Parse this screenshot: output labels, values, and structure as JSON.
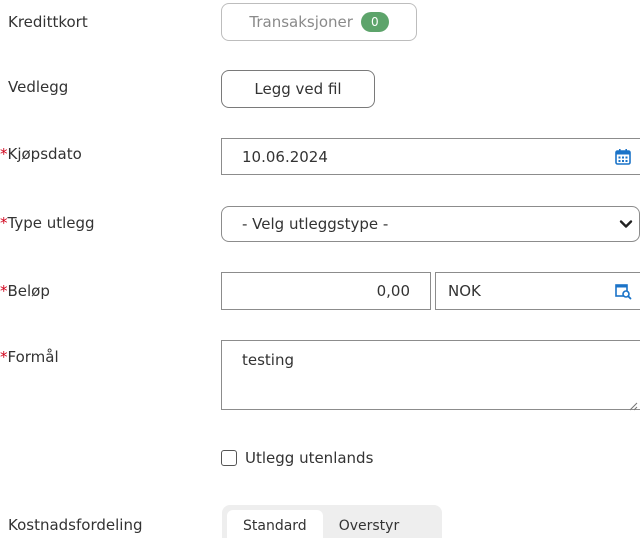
{
  "form": {
    "creditcard": {
      "label": "Kredittkort",
      "button_label": "Transaksjoner",
      "badge_count": "0"
    },
    "attachment": {
      "label": "Vedlegg",
      "button_label": "Legg ved fil"
    },
    "purchase_date": {
      "required_mark": "*",
      "label": "Kjøpsdato",
      "value": "10.06.2024"
    },
    "expense_type": {
      "required_mark": "*",
      "label": "Type utlegg",
      "value": "- Velg utleggstype -"
    },
    "amount": {
      "required_mark": "*",
      "label": "Beløp",
      "value": "0,00",
      "currency": "NOK"
    },
    "purpose": {
      "required_mark": "*",
      "label": "Formål",
      "value": "testing"
    },
    "abroad": {
      "label": "Utlegg utenlands",
      "checked": false
    },
    "cost_distribution": {
      "label": "Kostnadsfordeling",
      "options": [
        "Standard",
        "Overstyr"
      ],
      "selected": "Standard"
    }
  },
  "colors": {
    "required": "#d0021b",
    "badge": "#5da46b",
    "icon": "#1a73c8"
  }
}
